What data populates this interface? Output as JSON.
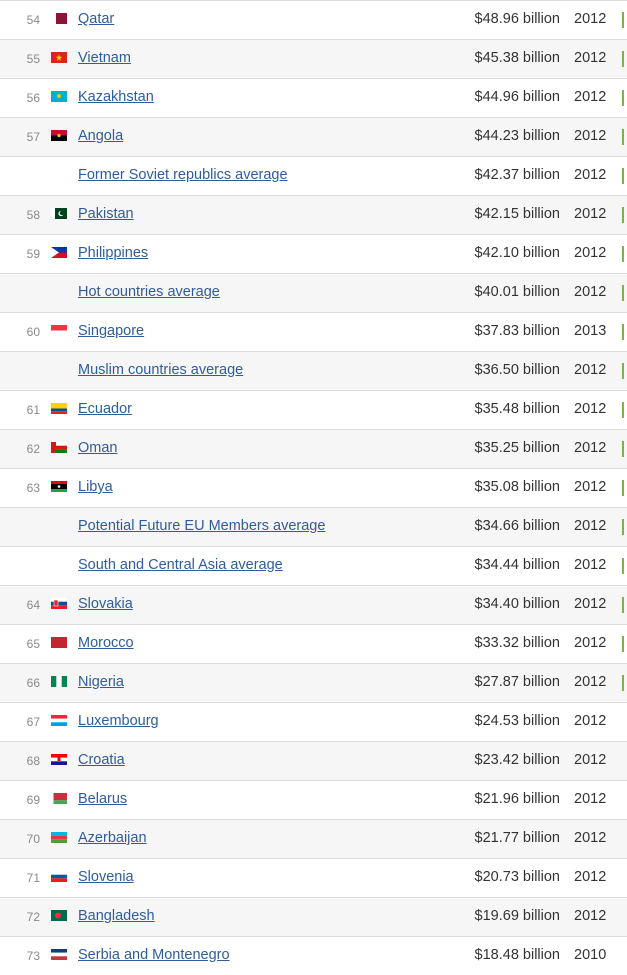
{
  "rows": [
    {
      "rank": "54",
      "country": "Qatar",
      "value": "$48.96 billion",
      "year": "2012",
      "flag": "qatar-flag",
      "bar": true
    },
    {
      "rank": "55",
      "country": "Vietnam",
      "value": "$45.38 billion",
      "year": "2012",
      "flag": "vietnam-flag",
      "bar": true
    },
    {
      "rank": "56",
      "country": "Kazakhstan",
      "value": "$44.96 billion",
      "year": "2012",
      "flag": "kazakhstan-flag",
      "bar": true
    },
    {
      "rank": "57",
      "country": "Angola",
      "value": "$44.23 billion",
      "year": "2012",
      "flag": "angola-flag",
      "bar": true
    },
    {
      "rank": "",
      "country": "Former Soviet republics average",
      "value": "$42.37 billion",
      "year": "2012",
      "flag": "",
      "bar": true
    },
    {
      "rank": "58",
      "country": "Pakistan",
      "value": "$42.15 billion",
      "year": "2012",
      "flag": "pakistan-flag",
      "bar": true
    },
    {
      "rank": "59",
      "country": "Philippines",
      "value": "$42.10 billion",
      "year": "2012",
      "flag": "philippines-flag",
      "bar": true
    },
    {
      "rank": "",
      "country": "Hot countries average",
      "value": "$40.01 billion",
      "year": "2012",
      "flag": "",
      "bar": true
    },
    {
      "rank": "60",
      "country": "Singapore",
      "value": "$37.83 billion",
      "year": "2013",
      "flag": "singapore-flag",
      "bar": true
    },
    {
      "rank": "",
      "country": "Muslim countries average",
      "value": "$36.50 billion",
      "year": "2012",
      "flag": "",
      "bar": true
    },
    {
      "rank": "61",
      "country": "Ecuador",
      "value": "$35.48 billion",
      "year": "2012",
      "flag": "ecuador-flag",
      "bar": true
    },
    {
      "rank": "62",
      "country": "Oman",
      "value": "$35.25 billion",
      "year": "2012",
      "flag": "oman-flag",
      "bar": true
    },
    {
      "rank": "63",
      "country": "Libya",
      "value": "$35.08 billion",
      "year": "2012",
      "flag": "libya-flag",
      "bar": true
    },
    {
      "rank": "",
      "country": "Potential Future EU Members average",
      "value": "$34.66 billion",
      "year": "2012",
      "flag": "",
      "bar": true
    },
    {
      "rank": "",
      "country": "South and Central Asia average",
      "value": "$34.44 billion",
      "year": "2012",
      "flag": "",
      "bar": true
    },
    {
      "rank": "64",
      "country": "Slovakia",
      "value": "$34.40 billion",
      "year": "2012",
      "flag": "slovakia-flag",
      "bar": true
    },
    {
      "rank": "65",
      "country": "Morocco",
      "value": "$33.32 billion",
      "year": "2012",
      "flag": "morocco-flag",
      "bar": true
    },
    {
      "rank": "66",
      "country": "Nigeria",
      "value": "$27.87 billion",
      "year": "2012",
      "flag": "nigeria-flag",
      "bar": true
    },
    {
      "rank": "67",
      "country": "Luxembourg",
      "value": "$24.53 billion",
      "year": "2012",
      "flag": "luxembourg-flag",
      "bar": false
    },
    {
      "rank": "68",
      "country": "Croatia",
      "value": "$23.42 billion",
      "year": "2012",
      "flag": "croatia-flag",
      "bar": false
    },
    {
      "rank": "69",
      "country": "Belarus",
      "value": "$21.96 billion",
      "year": "2012",
      "flag": "belarus-flag",
      "bar": false
    },
    {
      "rank": "70",
      "country": "Azerbaijan",
      "value": "$21.77 billion",
      "year": "2012",
      "flag": "azerbaijan-flag",
      "bar": false
    },
    {
      "rank": "71",
      "country": "Slovenia",
      "value": "$20.73 billion",
      "year": "2012",
      "flag": "slovenia-flag",
      "bar": false
    },
    {
      "rank": "72",
      "country": "Bangladesh",
      "value": "$19.69 billion",
      "year": "2012",
      "flag": "bangladesh-flag",
      "bar": false
    },
    {
      "rank": "73",
      "country": "Serbia and Montenegro",
      "value": "$18.48 billion",
      "year": "2010",
      "flag": "serbia-and-montenegro-flag",
      "bar": false
    }
  ]
}
